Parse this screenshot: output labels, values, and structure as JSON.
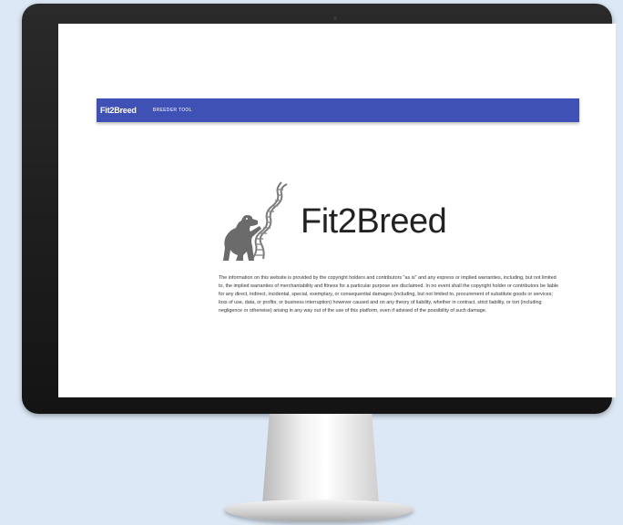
{
  "app": {
    "brand": "Fit2Breed",
    "nav_link": "BREEDER TOOL"
  },
  "logo": {
    "text": "Fit2Breed",
    "icon": "dog-dna-logo-icon"
  },
  "disclaimer": "The information on this website is provided by the copyright holders and contributors \"as is\" and any express or implied warranties, including, but not limited to, the implied warranties of merchantability and fitness for a particular purpose are disclaimed. In no event shall the copyright holder or contributors be liable for any direct, indirect, incidental, special, exemplary, or consequential damages (including, but not limited to, procurement of substitute goods or services; loss of use, data, or profits; or business interruption) however caused and on any theory of liability, whether in contract, strict liability, or tort (including negligence or otherwise) arising in any way out of the use of this platform, even if advised of the possibility of such damage.",
  "colors": {
    "navbar": "#3f51b5",
    "logo_gray": "#6b6b6b",
    "background": "#dce8f5"
  }
}
